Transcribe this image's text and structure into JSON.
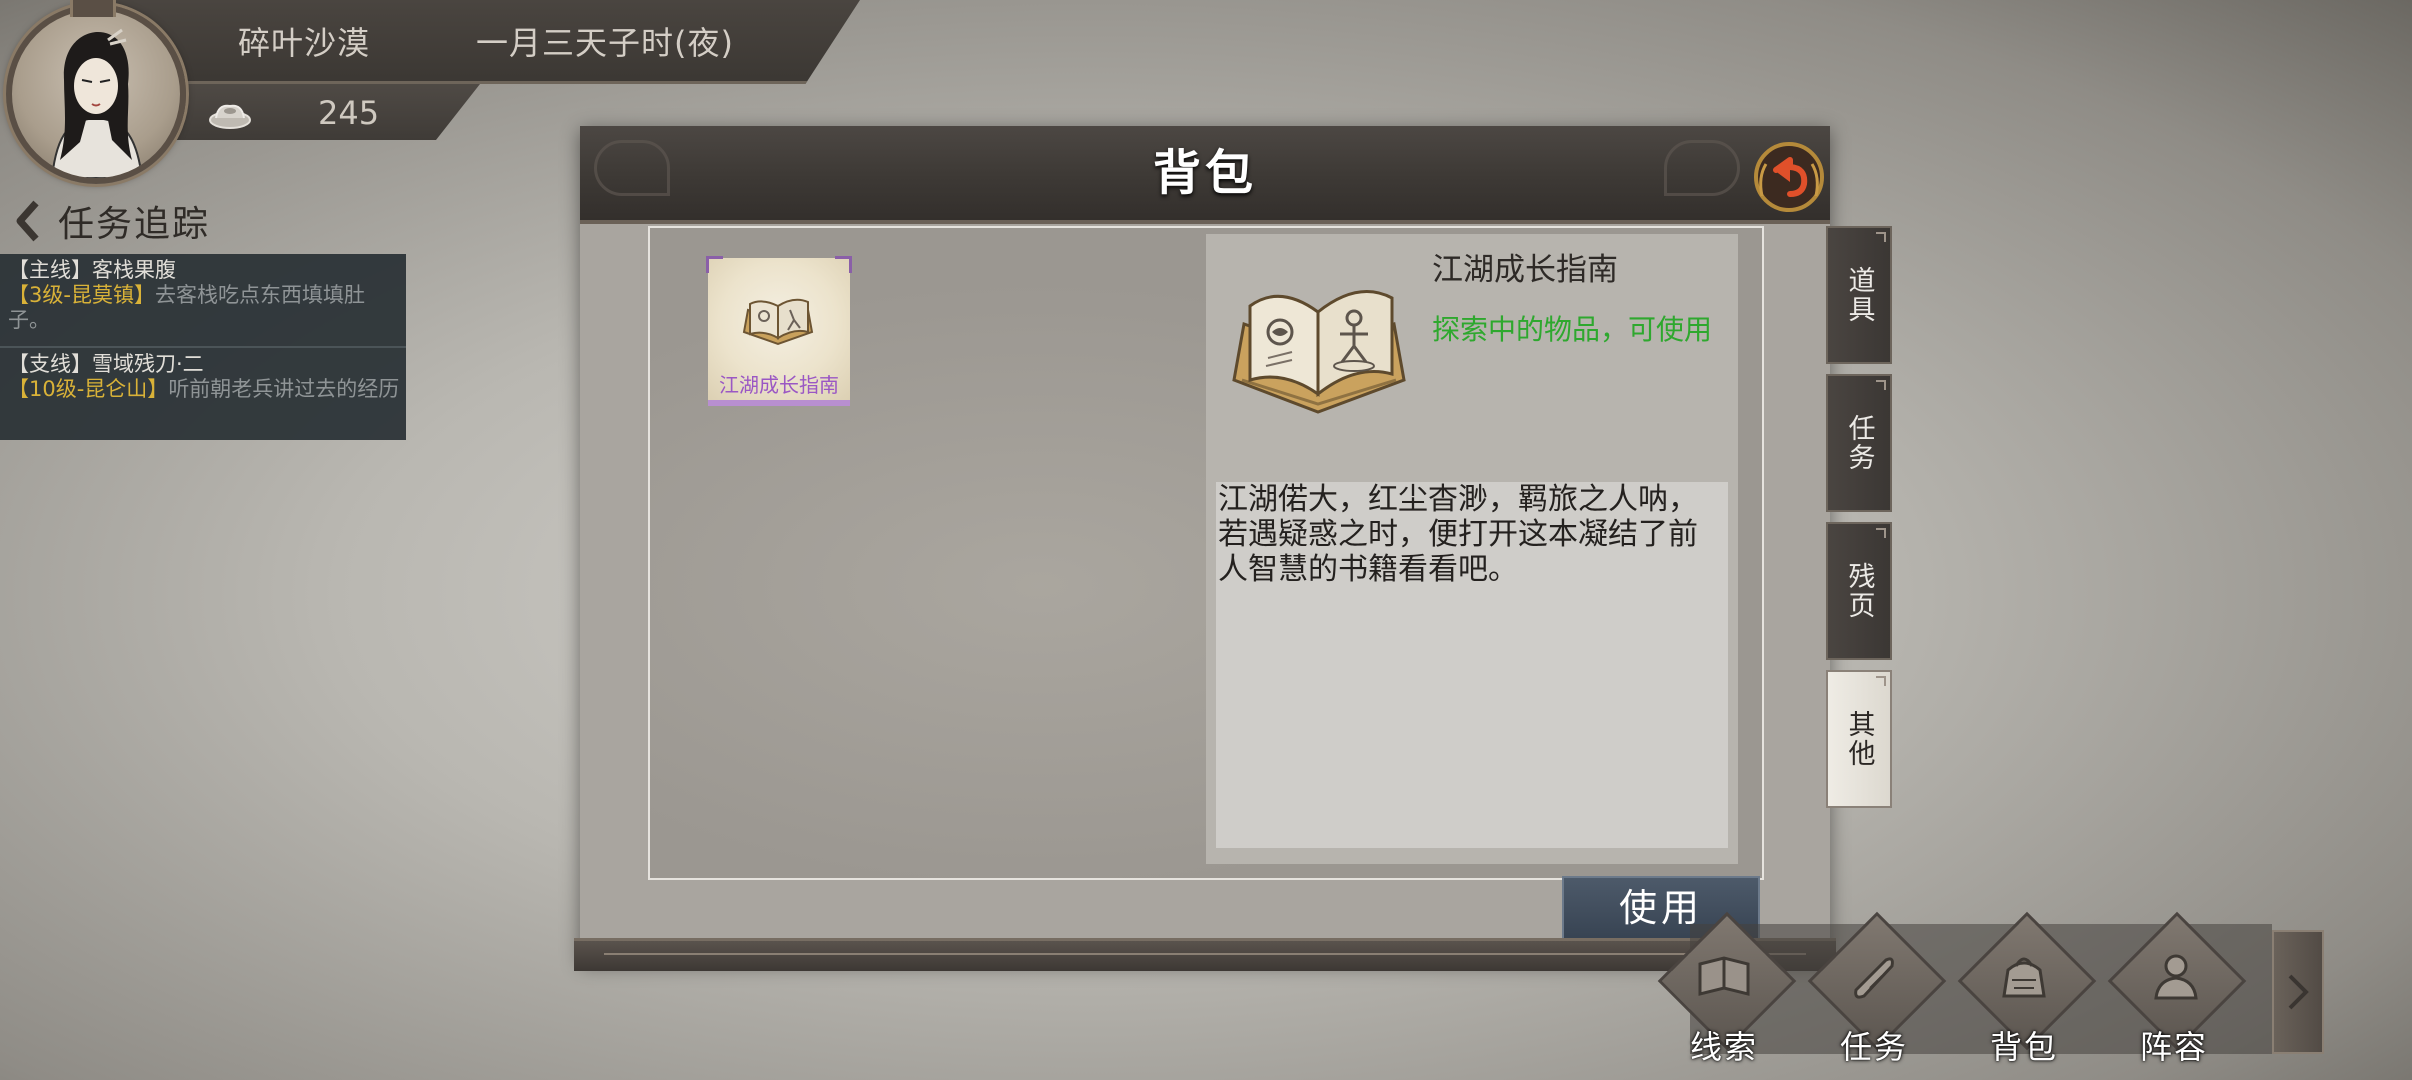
{
  "hud": {
    "location": "碎叶沙漠",
    "game_time": "一月三天子时(夜)",
    "silver": "245"
  },
  "quest_tracker": {
    "title": "任务追踪",
    "quests": [
      {
        "title": "【主线】客栈果腹",
        "tag": "【3级-昆莫镇】",
        "desc": "去客栈吃点东西填填肚子。"
      },
      {
        "title": "【支线】雪域残刀·二",
        "tag": "【10级-昆仑山】",
        "desc": "听前朝老兵讲过去的经历"
      }
    ]
  },
  "bag": {
    "title": "背包",
    "items": [
      {
        "name": "江湖成长指南"
      }
    ],
    "detail": {
      "name": "江湖成长指南",
      "subtitle": "探索中的物品，可使用",
      "description": "江湖偌大，红尘杳渺，羁旅之人呐，若遇疑惑之时，便打开这本凝结了前人智慧的书籍看看吧。"
    },
    "use_label": "使用"
  },
  "side_tabs": [
    {
      "label": "道具",
      "active": false
    },
    {
      "label": "任务",
      "active": false
    },
    {
      "label": "残页",
      "active": false
    },
    {
      "label": "其他",
      "active": true
    }
  ],
  "bottom_nav": [
    {
      "label": "线索",
      "icon": "book-icon"
    },
    {
      "label": "任务",
      "icon": "scroll-icon"
    },
    {
      "label": "背包",
      "icon": "bag-icon"
    },
    {
      "label": "阵容",
      "icon": "team-icon"
    }
  ],
  "colors": {
    "item_subtitle": "#2ea82e",
    "quest_tag": "#d9b238",
    "item_label": "#9a57c4"
  }
}
